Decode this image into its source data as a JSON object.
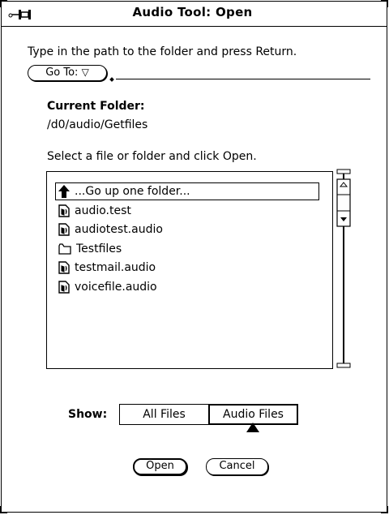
{
  "window": {
    "title": "Audio Tool: Open"
  },
  "path": {
    "instruction": "Type in the path to the folder and press Return.",
    "goto_label": "Go To:",
    "goto_arrow": "▽",
    "value": ""
  },
  "folder": {
    "label": "Current Folder:",
    "value": "/d0/audio/Getfiles"
  },
  "list": {
    "instruction": "Select a file or folder and click Open.",
    "items": [
      {
        "label": "...Go up one folder...",
        "icon": "up-arrow-icon"
      },
      {
        "label": "audio.test",
        "icon": "audio-file-icon"
      },
      {
        "label": "audiotest.audio",
        "icon": "audio-file-icon"
      },
      {
        "label": "Testfiles",
        "icon": "folder-icon"
      },
      {
        "label": "testmail.audio",
        "icon": "audio-file-icon"
      },
      {
        "label": "voicefile.audio",
        "icon": "audio-file-icon"
      }
    ]
  },
  "show": {
    "label": "Show:",
    "options": [
      "All Files",
      "Audio Files"
    ],
    "selected": "Audio Files"
  },
  "buttons": {
    "open": "Open",
    "cancel": "Cancel"
  }
}
